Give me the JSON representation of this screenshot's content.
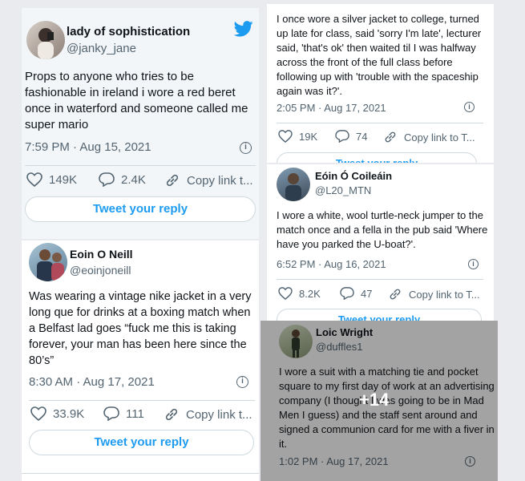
{
  "tweets": [
    {
      "name": "lady of sophistication",
      "handle": "@janky_jane",
      "text": "Props to anyone who tries to be fashionable in ireland i wore a red beret once in waterford and someone called me super mario",
      "timestamp": "7:59 PM · Aug 15, 2021",
      "likes": "149K",
      "replies": "2.4K",
      "copy_link": "Copy link t...",
      "reply_button": "Tweet your reply"
    },
    {
      "name": "",
      "handle": "",
      "text": "I once wore a silver jacket to college, turned up late for class, said 'sorry I'm late', lecturer said, 'that's ok' then waited til I was halfway across the front of the full class before following up with 'trouble with the spaceship again was it?'.",
      "timestamp": "2:05 PM · Aug 17, 2021",
      "likes": "19K",
      "replies": "74",
      "copy_link": "Copy link to T...",
      "reply_button": "Tweet your reply"
    },
    {
      "name": "Eóin Ó Coileáin",
      "handle": "@L20_MTN",
      "text": "I wore a white, wool turtle-neck jumper to the match once and a fella in the pub said 'Where have you parked the U-boat?'.",
      "timestamp": "6:52 PM · Aug 16, 2021",
      "likes": "8.2K",
      "replies": "47",
      "copy_link": "Copy link to T...",
      "reply_button": "Tweet your reply"
    },
    {
      "name": "Eoin O Neill",
      "handle": "@eoinjoneill",
      "text": "Was wearing a vintage nike jacket in a very long que for drinks at a boxing match when a Belfast lad goes “fuck me this is taking forever, your man has been here since the 80’s”",
      "timestamp": "8:30 AM · Aug 17, 2021",
      "likes": "33.9K",
      "replies": "111",
      "copy_link": "Copy link t...",
      "reply_button": "Tweet your reply"
    },
    {
      "name": "Loic Wright",
      "handle": "@duffles1",
      "text": "I wore a suit with a matching tie and pocket square to my first day of work at an advertising company (I thought I was going to be in Mad Men I guess) and the staff sent around and signed a communion card for me with a fiver in it.",
      "timestamp": "1:02 PM · Aug 17, 2021"
    }
  ],
  "gallery": {
    "more_count": "+14"
  },
  "colors": {
    "accent": "#1d9bf0",
    "text": "#0f1419",
    "muted": "#536471",
    "border": "#cfd9de"
  },
  "icons": [
    "twitter-bird-icon",
    "heart-icon",
    "reply-bubble-icon",
    "link-icon",
    "info-icon"
  ]
}
